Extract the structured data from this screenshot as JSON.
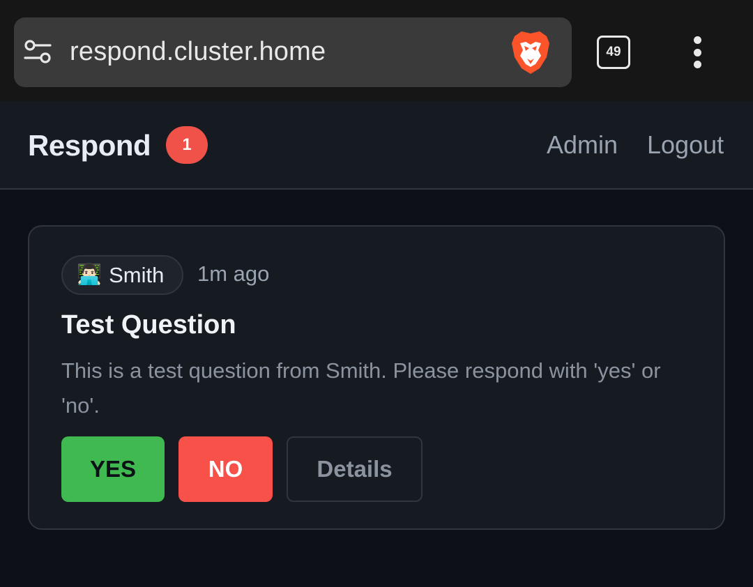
{
  "browser": {
    "url": "respond.cluster.home",
    "tab_count": "49",
    "icons": {
      "site_settings": "tune-icon",
      "brave": "brave-lion-icon",
      "menu": "more-vert-icon"
    },
    "colors": {
      "brave_orange": "#fb542b"
    }
  },
  "header": {
    "brand": "Respond",
    "badge_count": "1",
    "nav": {
      "admin": "Admin",
      "logout": "Logout"
    }
  },
  "card": {
    "sender": {
      "avatar": "👨🏻‍💻",
      "name": "Smith"
    },
    "timestamp": "1m ago",
    "title": "Test Question",
    "body": "This is a test question from Smith. Please respond with 'yes' or 'no'.",
    "buttons": {
      "yes": "YES",
      "no": "NO",
      "details": "Details"
    }
  },
  "colors": {
    "background": "#0d1117",
    "surface": "#161b22",
    "border": "#30363d",
    "badge": "#f0524a",
    "yes": "#3fb950",
    "no": "#f85149"
  }
}
